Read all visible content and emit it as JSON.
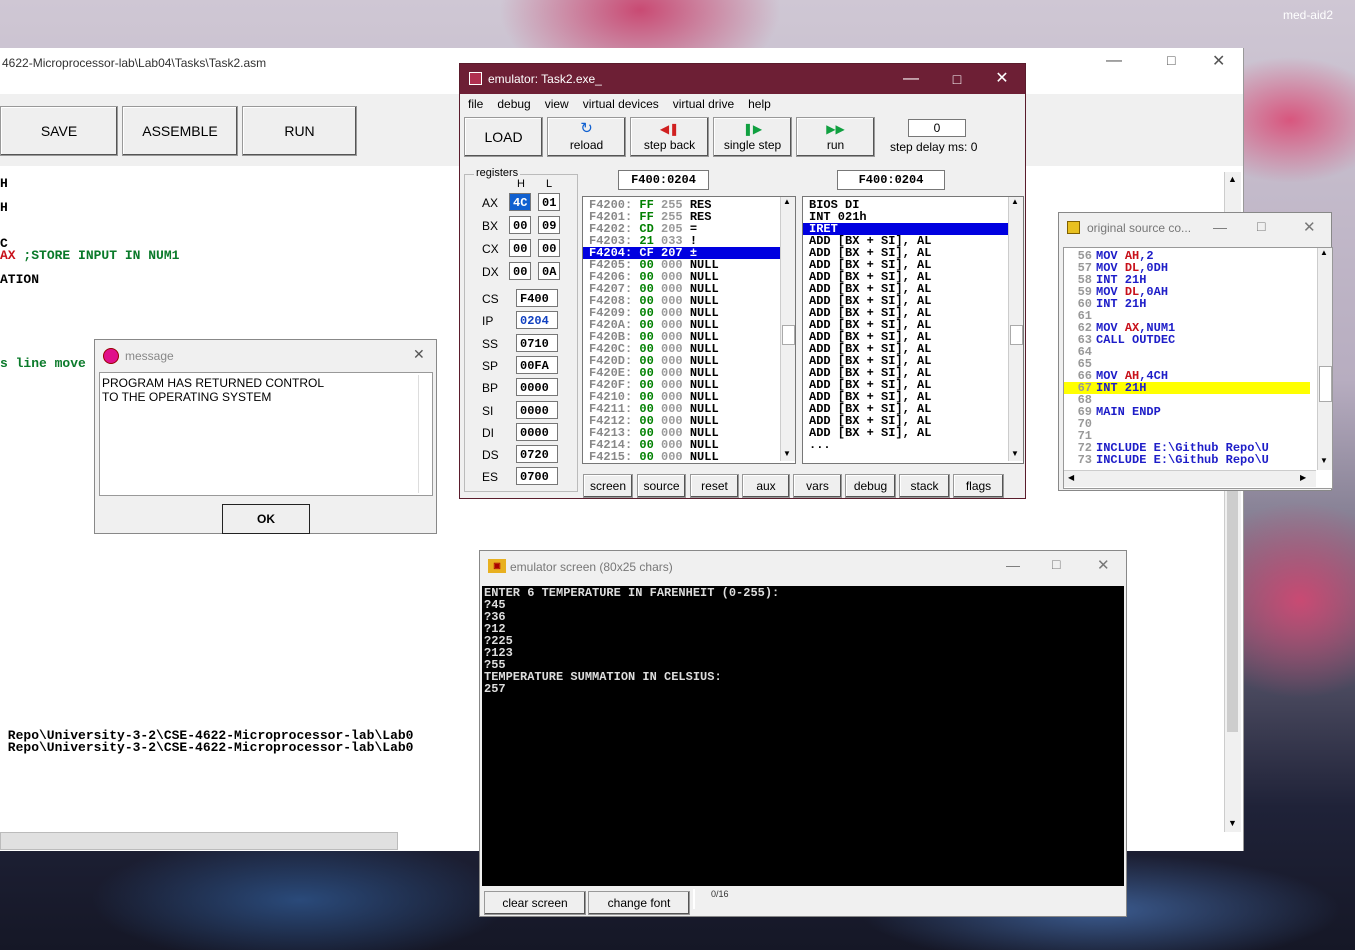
{
  "desktop": {
    "user_label": "med-aid2"
  },
  "editor": {
    "path": "4622-Microprocessor-lab\\Lab04\\Tasks\\Task2.asm",
    "buttons": {
      "save": "SAVE",
      "assemble": "ASSEMBLE",
      "run": "RUN"
    },
    "code_fragments": [
      {
        "text": "H",
        "color": "#000000"
      },
      {
        "text": "H",
        "color": "#000000"
      },
      {
        "text": "C",
        "color": "#000000"
      },
      {
        "text": "AX ;STORE INPUT IN NUM1",
        "color": "#0a7a2a"
      },
      {
        "text": "ATION",
        "color": "#000000"
      },
      {
        "text": "s line move",
        "color": "#0a7a2a"
      },
      {
        "text": " Repo\\University-3-2\\CSE-4622-Microprocessor-lab\\Lab0",
        "color": "#000000"
      },
      {
        "text": " Repo\\University-3-2\\CSE-4622-Microprocessor-lab\\Lab0",
        "color": "#000000"
      }
    ]
  },
  "message": {
    "title": "message",
    "text_line1": "PROGRAM HAS RETURNED CONTROL",
    "text_line2": "TO THE OPERATING SYSTEM",
    "ok": "OK"
  },
  "emulator": {
    "title": "emulator: Task2.exe_",
    "menu": [
      "file",
      "debug",
      "view",
      "virtual devices",
      "virtual drive",
      "help"
    ],
    "toolbar": {
      "load": "LOAD",
      "reload": "reload",
      "step_back": "step back",
      "single_step": "single step",
      "run": "run",
      "step_delay_value": "0",
      "step_delay_label": "step delay ms: 0"
    },
    "registers_label": "registers",
    "h_label": "H",
    "l_label": "L",
    "gp_registers": [
      {
        "name": "AX",
        "h": "4C",
        "l": "01"
      },
      {
        "name": "BX",
        "h": "00",
        "l": "09"
      },
      {
        "name": "CX",
        "h": "00",
        "l": "00"
      },
      {
        "name": "DX",
        "h": "00",
        "l": "0A"
      }
    ],
    "seg_registers": [
      {
        "name": "CS",
        "value": "F400"
      },
      {
        "name": "IP",
        "value": "0204"
      },
      {
        "name": "SS",
        "value": "0710"
      },
      {
        "name": "SP",
        "value": "00FA"
      },
      {
        "name": "BP",
        "value": "0000"
      },
      {
        "name": "SI",
        "value": "0000"
      },
      {
        "name": "DI",
        "value": "0000"
      },
      {
        "name": "DS",
        "value": "0720"
      },
      {
        "name": "ES",
        "value": "0700"
      }
    ],
    "mem_addr": "F400:0204",
    "dis_addr": "F400:0204",
    "memory": [
      {
        "addr": "F4200:",
        "hex": "FF",
        "dec": "255",
        "ch": "RES"
      },
      {
        "addr": "F4201:",
        "hex": "FF",
        "dec": "255",
        "ch": "RES"
      },
      {
        "addr": "F4202:",
        "hex": "CD",
        "dec": "205",
        "ch": "="
      },
      {
        "addr": "F4203:",
        "hex": "21",
        "dec": "033",
        "ch": "!"
      },
      {
        "addr": "F4204:",
        "hex": "CF",
        "dec": "207",
        "ch": "±"
      },
      {
        "addr": "F4205:",
        "hex": "00",
        "dec": "000",
        "ch": "NULL"
      },
      {
        "addr": "F4206:",
        "hex": "00",
        "dec": "000",
        "ch": "NULL"
      },
      {
        "addr": "F4207:",
        "hex": "00",
        "dec": "000",
        "ch": "NULL"
      },
      {
        "addr": "F4208:",
        "hex": "00",
        "dec": "000",
        "ch": "NULL"
      },
      {
        "addr": "F4209:",
        "hex": "00",
        "dec": "000",
        "ch": "NULL"
      },
      {
        "addr": "F420A:",
        "hex": "00",
        "dec": "000",
        "ch": "NULL"
      },
      {
        "addr": "F420B:",
        "hex": "00",
        "dec": "000",
        "ch": "NULL"
      },
      {
        "addr": "F420C:",
        "hex": "00",
        "dec": "000",
        "ch": "NULL"
      },
      {
        "addr": "F420D:",
        "hex": "00",
        "dec": "000",
        "ch": "NULL"
      },
      {
        "addr": "F420E:",
        "hex": "00",
        "dec": "000",
        "ch": "NULL"
      },
      {
        "addr": "F420F:",
        "hex": "00",
        "dec": "000",
        "ch": "NULL"
      },
      {
        "addr": "F4210:",
        "hex": "00",
        "dec": "000",
        "ch": "NULL"
      },
      {
        "addr": "F4211:",
        "hex": "00",
        "dec": "000",
        "ch": "NULL"
      },
      {
        "addr": "F4212:",
        "hex": "00",
        "dec": "000",
        "ch": "NULL"
      },
      {
        "addr": "F4213:",
        "hex": "00",
        "dec": "000",
        "ch": "NULL"
      },
      {
        "addr": "F4214:",
        "hex": "00",
        "dec": "000",
        "ch": "NULL"
      },
      {
        "addr": "F4215:",
        "hex": "00",
        "dec": "000",
        "ch": "NULL"
      }
    ],
    "memory_selected": 4,
    "disasm": [
      "BIOS DI",
      "INT 021h",
      "IRET",
      "ADD [BX + SI], AL",
      "ADD [BX + SI], AL",
      "ADD [BX + SI], AL",
      "ADD [BX + SI], AL",
      "ADD [BX + SI], AL",
      "ADD [BX + SI], AL",
      "ADD [BX + SI], AL",
      "ADD [BX + SI], AL",
      "ADD [BX + SI], AL",
      "ADD [BX + SI], AL",
      "ADD [BX + SI], AL",
      "ADD [BX + SI], AL",
      "ADD [BX + SI], AL",
      "ADD [BX + SI], AL",
      "ADD [BX + SI], AL",
      "ADD [BX + SI], AL",
      "ADD [BX + SI], AL",
      "..."
    ],
    "disasm_selected": 2,
    "bottom_buttons": [
      "screen",
      "source",
      "reset",
      "aux",
      "vars",
      "debug",
      "stack",
      "flags"
    ]
  },
  "source": {
    "title": "original source co...",
    "lines": [
      {
        "n": "56",
        "kw": "MOV",
        "rest": " ",
        "reg": "AH",
        "tail": ",2"
      },
      {
        "n": "57",
        "kw": "MOV",
        "rest": " ",
        "reg": "DL",
        "tail": ",0DH"
      },
      {
        "n": "58",
        "kw": "INT",
        "rest": " 21H",
        "reg": "",
        "tail": ""
      },
      {
        "n": "59",
        "kw": "MOV",
        "rest": " ",
        "reg": "DL",
        "tail": ",0AH"
      },
      {
        "n": "60",
        "kw": "INT",
        "rest": " 21H",
        "reg": "",
        "tail": ""
      },
      {
        "n": "61",
        "kw": "",
        "rest": "",
        "reg": "",
        "tail": ""
      },
      {
        "n": "62",
        "kw": "MOV",
        "rest": " ",
        "reg": "AX",
        "tail": ",NUM1"
      },
      {
        "n": "63",
        "kw": "CALL",
        "rest": " OUTDEC",
        "reg": "",
        "tail": ""
      },
      {
        "n": "64",
        "kw": "",
        "rest": "",
        "reg": "",
        "tail": ""
      },
      {
        "n": "65",
        "kw": "",
        "rest": "",
        "reg": "",
        "tail": ""
      },
      {
        "n": "66",
        "kw": "MOV",
        "rest": " ",
        "reg": "AH",
        "tail": ",4CH"
      },
      {
        "n": "67",
        "kw": "INT",
        "rest": " 21H",
        "reg": "",
        "tail": ""
      },
      {
        "n": "68",
        "kw": "",
        "rest": "",
        "reg": "",
        "tail": ""
      },
      {
        "n": "69",
        "kw": "",
        "rest": "MAIN ENDP",
        "reg": "",
        "tail": ""
      },
      {
        "n": "70",
        "kw": "",
        "rest": "",
        "reg": "",
        "tail": ""
      },
      {
        "n": "71",
        "kw": "",
        "rest": "",
        "reg": "",
        "tail": ""
      },
      {
        "n": "72",
        "kw": "INCLUDE",
        "rest": " E:\\Github Repo\\U",
        "reg": "",
        "tail": ""
      },
      {
        "n": "73",
        "kw": "INCLUDE",
        "rest": " E:\\Github Repo\\U",
        "reg": "",
        "tail": ""
      }
    ],
    "highlight_index": 11
  },
  "screen": {
    "title": "emulator screen (80x25 chars)",
    "lines": [
      "ENTER 6 TEMPERATURE IN FARENHEIT (0-255):",
      "?45",
      "?36",
      "?12",
      "?225",
      "?123",
      "?55",
      "TEMPERATURE SUMMATION IN CELSIUS:",
      "257"
    ],
    "clear": "clear screen",
    "font": "change font",
    "progress": "0/16"
  },
  "colors": {
    "emu_title": "#6d1f35",
    "highlight_blue": "#0000e0",
    "highlight_yellow": "#ffff00",
    "hex_green": "#008000"
  }
}
